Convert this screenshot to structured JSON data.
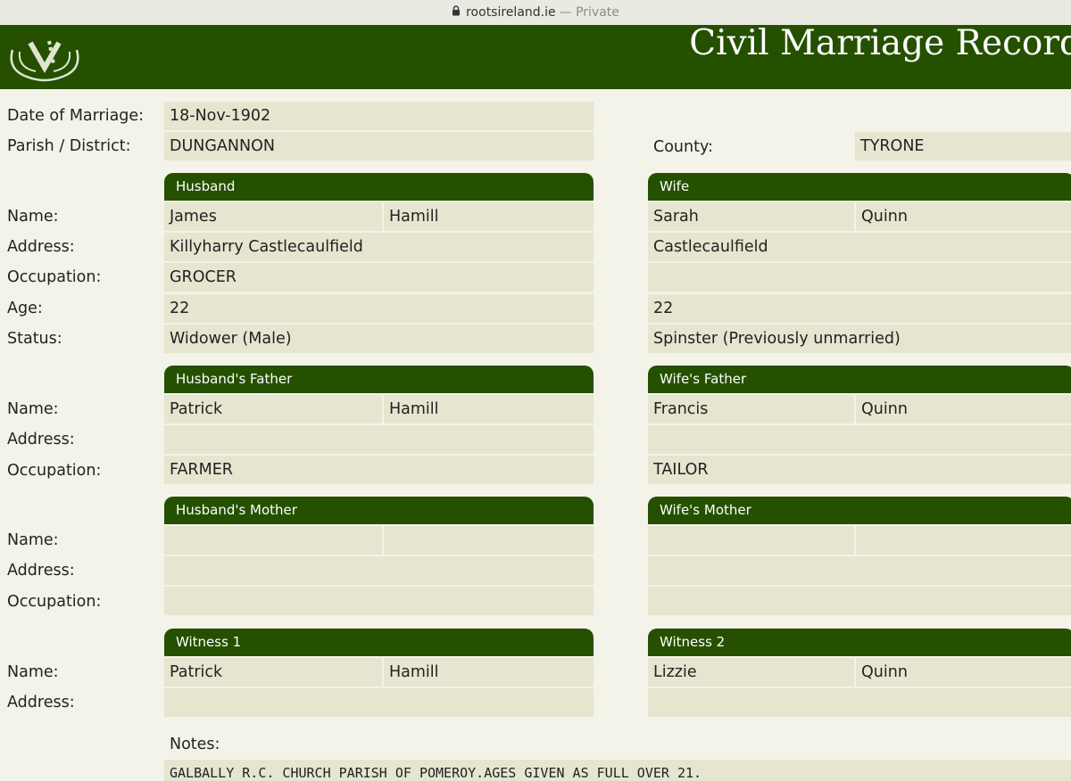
{
  "browser": {
    "domain": "rootsireland.ie",
    "separator": " — ",
    "private_label": "Private"
  },
  "header": {
    "title": "Civil Marriage Record"
  },
  "record": {
    "date_label": "Date of Marriage:",
    "date": "18-Nov-1902",
    "parish_label": "Parish / District:",
    "parish": "DUNGANNON",
    "county_label": "County:",
    "county": "TYRONE"
  },
  "row_labels": {
    "name": "Name:",
    "address": "Address:",
    "occupation": "Occupation:",
    "age": "Age:",
    "status": "Status:"
  },
  "husband": {
    "section": "Husband",
    "first": "James",
    "last": "Hamill",
    "address": "Killyharry Castlecaulfield",
    "occupation": "GROCER",
    "age": "22",
    "status": "Widower (Male)"
  },
  "wife": {
    "section": "Wife",
    "first": "Sarah",
    "last": "Quinn",
    "address": "Castlecaulfield",
    "occupation": "",
    "age": "22",
    "status": "Spinster (Previously unmarried)"
  },
  "husband_father": {
    "section": "Husband's Father",
    "first": "Patrick",
    "last": "Hamill",
    "address": "",
    "occupation": "FARMER"
  },
  "wife_father": {
    "section": "Wife's Father",
    "first": "Francis",
    "last": "Quinn",
    "address": "",
    "occupation": "TAILOR"
  },
  "husband_mother": {
    "section": "Husband's Mother",
    "first": "",
    "last": "",
    "address": "",
    "occupation": ""
  },
  "wife_mother": {
    "section": "Wife's Mother",
    "first": "",
    "last": "",
    "address": "",
    "occupation": ""
  },
  "witness1": {
    "section": "Witness 1",
    "first": "Patrick",
    "last": "Hamill",
    "address": ""
  },
  "witness2": {
    "section": "Witness 2",
    "first": "Lizzie",
    "last": "Quinn",
    "address": ""
  },
  "notes": {
    "label": "Notes:",
    "text": "GALBALLY R.C. CHURCH PARISH OF POMEROY.AGES GIVEN AS FULL OVER 21."
  },
  "colors": {
    "header_green": "#245000",
    "cell_bg": "#e6e5d0",
    "page_bg": "#f4f3e9"
  }
}
